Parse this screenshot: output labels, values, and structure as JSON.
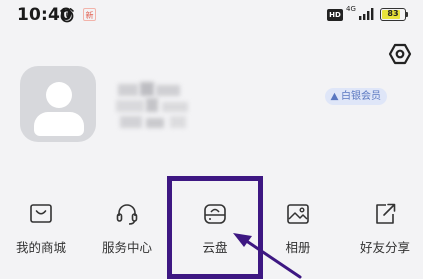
{
  "status_bar": {
    "time": "10:40",
    "notification_badge": "新",
    "hd_label": "HD",
    "network_type": "4G",
    "battery": "83",
    "battery_level_percent": 83
  },
  "profile": {
    "vip_label": "白银会员"
  },
  "menu": {
    "items": [
      {
        "label": "我的商城",
        "icon": "shop-icon"
      },
      {
        "label": "服务中心",
        "icon": "headset-icon"
      },
      {
        "label": "云盘",
        "icon": "cloud-disk-icon"
      },
      {
        "label": "相册",
        "icon": "photo-album-icon"
      },
      {
        "label": "好友分享",
        "icon": "share-icon"
      }
    ]
  },
  "annotation": {
    "highlight_color": "#3d1782",
    "target": "云盘"
  }
}
